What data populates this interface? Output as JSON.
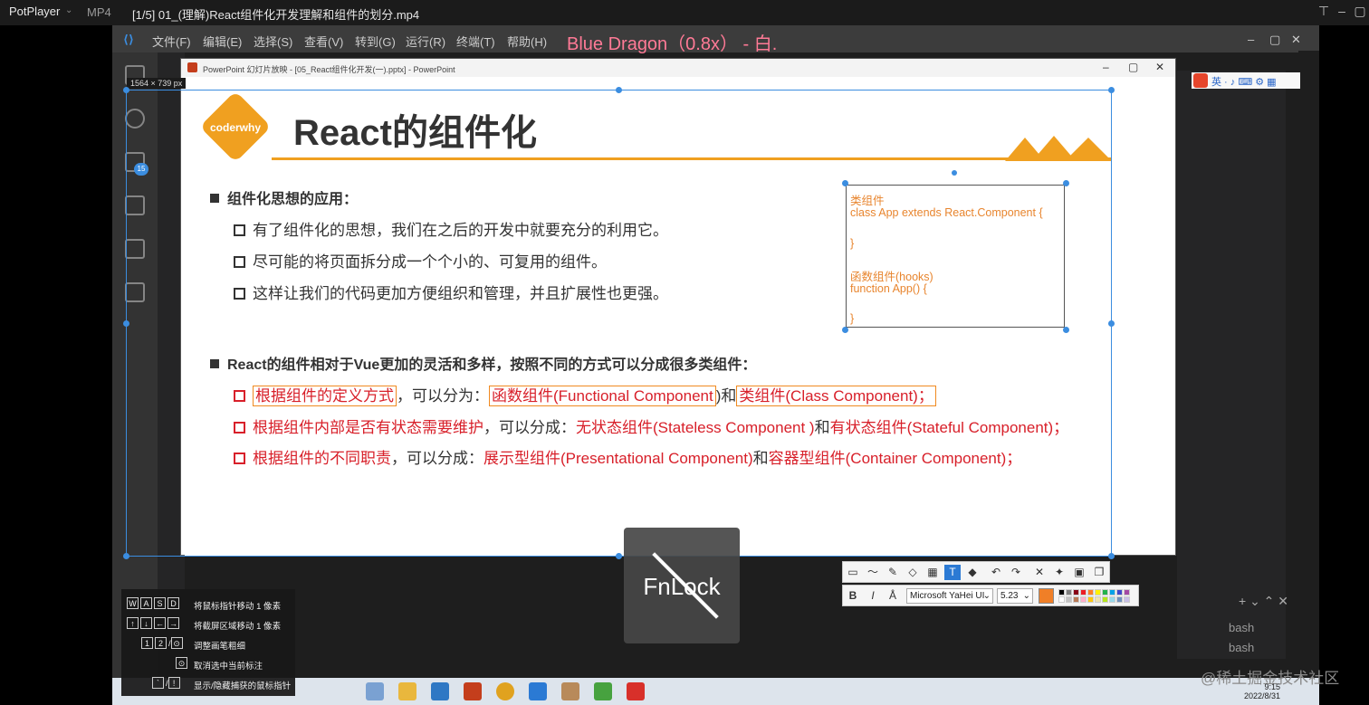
{
  "player": {
    "name": "PotPlayer",
    "format": "MP4",
    "file_title": "[1/5] 01_(理解)React组件化开发理解和组件的划分.mp4"
  },
  "subtitle_overlay": "Blue Dragon（0.8x） - 白.",
  "selection_size": "1564 × 739    px",
  "vscode": {
    "menu": [
      "文件(F)",
      "编辑(E)",
      "选择(S)",
      "查看(V)",
      "转到(G)",
      "运行(R)",
      "终端(T)",
      "帮助(H)"
    ],
    "badge": "15"
  },
  "ppt": {
    "window_title": "PowerPoint 幻灯片放映 - [05_React组件化开发(一).pptx] - PowerPoint"
  },
  "slide": {
    "logo": "coderwhy",
    "title": "React的组件化",
    "section1": "组件化思想的应用：",
    "items1": [
      "有了组件化的思想，我们在之后的开发中就要充分的利用它。",
      "尽可能的将页面拆分成一个个小的、可复用的组件。",
      "这样让我们的代码更加方便组织和管理，并且扩展性也更强。"
    ],
    "section2": "React的组件相对于Vue更加的灵活和多样，按照不同的方式可以分成很多类组件：",
    "row1": {
      "a": "根据组件的定义方式",
      "b": "，可以分为：",
      "c": "函数组件(Functional Component",
      "d": ")和",
      "e": "类组件(Class Component)；"
    },
    "row2": {
      "a": "根据组件内部是否有状态需要维护",
      "b": "，可以分成：",
      "c": "无状态组件(Stateless Component )",
      "d": "和",
      "e": "有状态组件(Stateful Component)；"
    },
    "row3": {
      "a": "根据组件的不同职责",
      "b": "，可以分成：",
      "c": "展示型组件(Presentational Component)",
      "d": "和",
      "e": "容器型组件(Container Component)；"
    },
    "code": [
      "类组件",
      "class App extends React.Component {",
      "",
      "}",
      "",
      "函数组件(hooks)",
      "function App() {",
      "",
      "}"
    ]
  },
  "annotation_toolbar": {
    "font": "Microsoft YaHei UI",
    "size": "5.23",
    "bold_label": "B",
    "italic_label": "I",
    "text_tool_label": "T",
    "colors": [
      "#000000",
      "#7f7f7f",
      "#880015",
      "#ed1c24",
      "#ff7f27",
      "#fff200",
      "#22b14c",
      "#00a2e8",
      "#3f48cc",
      "#a349a4",
      "#ffffff",
      "#c3c3c3",
      "#b97a57",
      "#ffaec9",
      "#ffc90e",
      "#efe4b0",
      "#b5e61d",
      "#99d9ea",
      "#7092be",
      "#c8bfe7"
    ],
    "current_color": "#f07f27"
  },
  "help_panel": [
    {
      "keys": [
        "W",
        "A",
        "S",
        "D"
      ],
      "desc": "将鼠标指针移动 1 像素"
    },
    {
      "keys": [
        "↑",
        "↓",
        "←",
        "→"
      ],
      "desc": "将截屏区域移动 1 像素"
    },
    {
      "keys": [
        "1",
        "2",
        "/",
        "⊙"
      ],
      "desc": "调整画笔粗细"
    },
    {
      "keys": [
        "⊙"
      ],
      "desc": "取消选中当前标注"
    },
    {
      "keys": [
        "`",
        "/",
        "!"
      ],
      "desc": "显示/隐藏捕获的鼠标指针"
    }
  ],
  "fnlock": "FnLock",
  "terminal": [
    "bash",
    "bash"
  ],
  "watermark": "@稀土掘金技术社区",
  "clock": {
    "time": "9:15",
    "date": "2022/8/31"
  }
}
